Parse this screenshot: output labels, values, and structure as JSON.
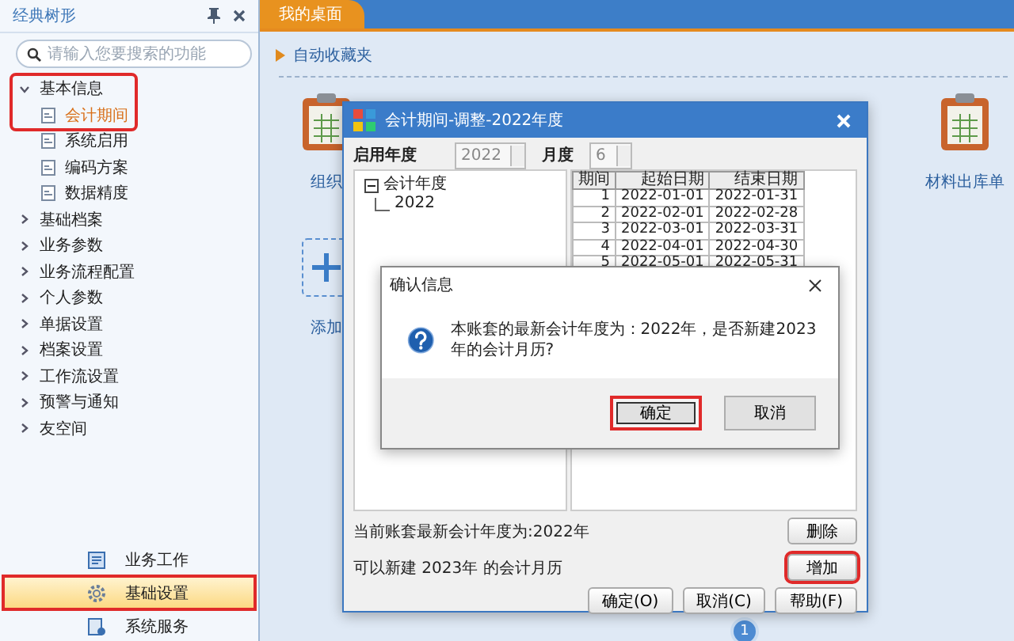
{
  "sidebar": {
    "title": "经典树形",
    "search": {
      "placeholder": "请输入您要搜索的功能"
    },
    "tree": [
      {
        "label": "基本信息",
        "expanded": true,
        "highlighted": true,
        "children": [
          {
            "label": "会计期间",
            "selected": true,
            "highlighted": true
          },
          {
            "label": "系统启用",
            "selected": false,
            "highlighted": false
          },
          {
            "label": "编码方案",
            "selected": false,
            "highlighted": false
          },
          {
            "label": "数据精度",
            "selected": false,
            "highlighted": false
          }
        ]
      },
      {
        "label": "基础档案",
        "expanded": false,
        "highlighted": false
      },
      {
        "label": "业务参数",
        "expanded": false,
        "highlighted": false
      },
      {
        "label": "业务流程配置",
        "expanded": false,
        "highlighted": false
      },
      {
        "label": "个人参数",
        "expanded": false,
        "highlighted": false
      },
      {
        "label": "单据设置",
        "expanded": false,
        "highlighted": false
      },
      {
        "label": "档案设置",
        "expanded": false,
        "highlighted": false
      },
      {
        "label": "工作流设置",
        "expanded": false,
        "highlighted": false
      },
      {
        "label": "预警与通知",
        "expanded": false,
        "highlighted": false
      },
      {
        "label": "友空间",
        "expanded": false,
        "highlighted": false
      }
    ],
    "nav": [
      {
        "label": "业务工作",
        "kind": "work",
        "selected": false,
        "highlighted": false
      },
      {
        "label": "基础设置",
        "kind": "gear",
        "selected": true,
        "highlighted": true
      },
      {
        "label": "系统服务",
        "kind": "service",
        "selected": false,
        "highlighted": false
      }
    ]
  },
  "tabs": [
    {
      "label": "我的桌面",
      "selected": true
    }
  ],
  "desktop": {
    "favorites": "自动收藏夹",
    "icons": [
      {
        "label": "组织",
        "kind": "clipboard"
      },
      {
        "label": "材料出库单",
        "kind": "clipboard"
      },
      {
        "label": "添加",
        "kind": "add"
      }
    ],
    "page": "1"
  },
  "dialog": {
    "title": "会计期间-调整-2022年度",
    "year_label": "启用年度",
    "year": "2022",
    "month_label": "月度",
    "month": "6",
    "tree": {
      "root": "会计年度",
      "children": [
        "2022"
      ]
    },
    "columns": [
      "期间",
      "起始日期",
      "结束日期"
    ],
    "rows": [
      [
        "1",
        "2022-01-01",
        "2022-01-31"
      ],
      [
        "2",
        "2022-02-01",
        "2022-02-28"
      ],
      [
        "3",
        "2022-03-01",
        "2022-03-31"
      ],
      [
        "4",
        "2022-04-01",
        "2022-04-30"
      ],
      [
        "5",
        "2022-05-01",
        "2022-05-31"
      ]
    ],
    "current_note": "当前账套最新会计年度为:2022年",
    "delete_button": {
      "label": "删除",
      "highlighted": false
    },
    "new_note": "可以新建 2023年 的会计月历",
    "add_button": {
      "label": "增加",
      "highlighted": true
    },
    "buttons": [
      {
        "label": "确定(O)"
      },
      {
        "label": "取消(C)"
      },
      {
        "label": "帮助(F)"
      }
    ]
  },
  "confirm": {
    "title": "确认信息",
    "message": "本账套的最新会计年度为：2022年，是否新建2023年的会计月历?",
    "buttons": [
      {
        "label": "确定",
        "highlighted": true,
        "default": true
      },
      {
        "label": "取消",
        "highlighted": false,
        "default": false
      }
    ]
  }
}
